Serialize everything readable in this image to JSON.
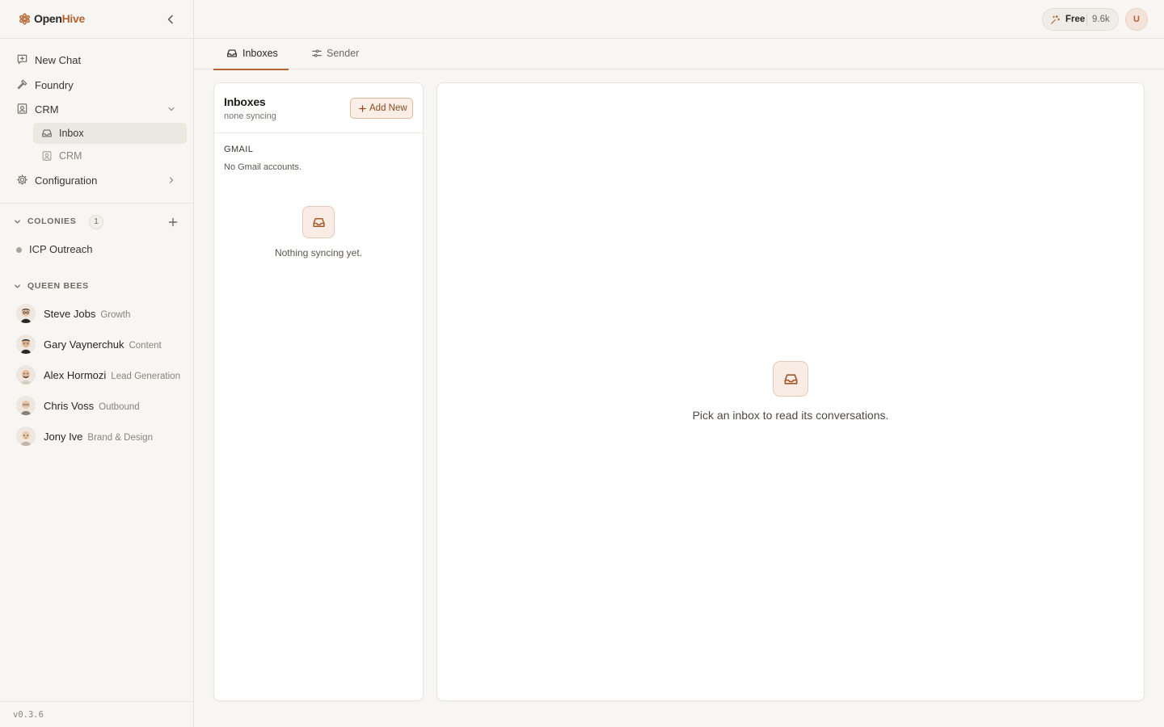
{
  "brand": {
    "name_part1": "Open",
    "name_part2": "Hive",
    "accent_color": "#b3632f"
  },
  "sidebar": {
    "nav": {
      "new_chat": "New Chat",
      "foundry": "Foundry",
      "crm": "CRM",
      "configuration": "Configuration"
    },
    "crm_sub": [
      {
        "label": "Inbox",
        "icon": "inbox-icon",
        "active": true
      },
      {
        "label": "CRM",
        "icon": "contact-card-icon",
        "active": false
      }
    ],
    "colonies": {
      "title": "COLONIES",
      "count": "1",
      "items": [
        {
          "label": "ICP Outreach"
        }
      ]
    },
    "queen_bees": {
      "title": "QUEEN BEES",
      "items": [
        {
          "name": "Steve Jobs",
          "role": "Growth"
        },
        {
          "name": "Gary Vaynerchuk",
          "role": "Content"
        },
        {
          "name": "Alex Hormozi",
          "role": "Lead Generation"
        },
        {
          "name": "Chris Voss",
          "role": "Outbound"
        },
        {
          "name": "Jony Ive",
          "role": "Brand & Design"
        }
      ]
    },
    "version": "v0.3.6"
  },
  "header": {
    "plan": "Free",
    "credits": "9.6k",
    "user_initial": "U"
  },
  "tabs": [
    {
      "label": "Inboxes",
      "icon": "inbox-icon",
      "active": true
    },
    {
      "label": "Sender",
      "icon": "sliders-icon",
      "active": false
    }
  ],
  "inboxes_panel": {
    "title": "Inboxes",
    "subtitle": "none syncing",
    "add_button": "Add New",
    "provider_title": "GMAIL",
    "provider_empty": "No Gmail accounts.",
    "empty_state": "Nothing syncing yet."
  },
  "reader_panel": {
    "empty_state": "Pick an inbox to read its conversations."
  }
}
